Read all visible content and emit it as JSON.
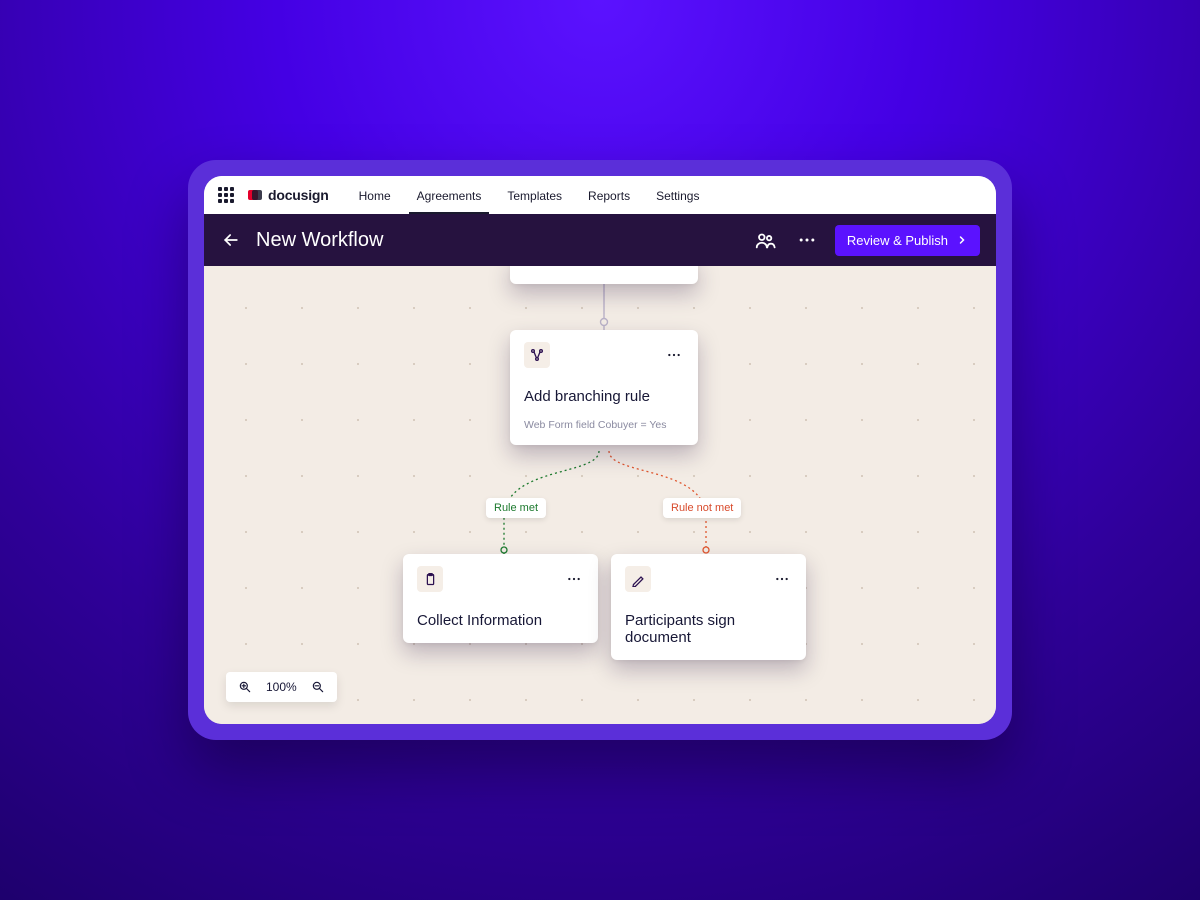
{
  "brand": {
    "name": "docusign"
  },
  "nav": {
    "items": [
      "Home",
      "Agreements",
      "Templates",
      "Reports",
      "Settings"
    ],
    "activeIndex": 1
  },
  "page": {
    "title": "New Workflow",
    "primaryAction": "Review & Publish"
  },
  "zoom": {
    "level": "100%"
  },
  "branchNode": {
    "title": "Add branching rule",
    "subtitle": "Web Form field  Cobuyer = Yes"
  },
  "labels": {
    "ruleMet": "Rule met",
    "ruleNotMet": "Rule not met"
  },
  "leftNode": {
    "title": "Collect Information"
  },
  "rightNode": {
    "title": "Participants sign document"
  }
}
